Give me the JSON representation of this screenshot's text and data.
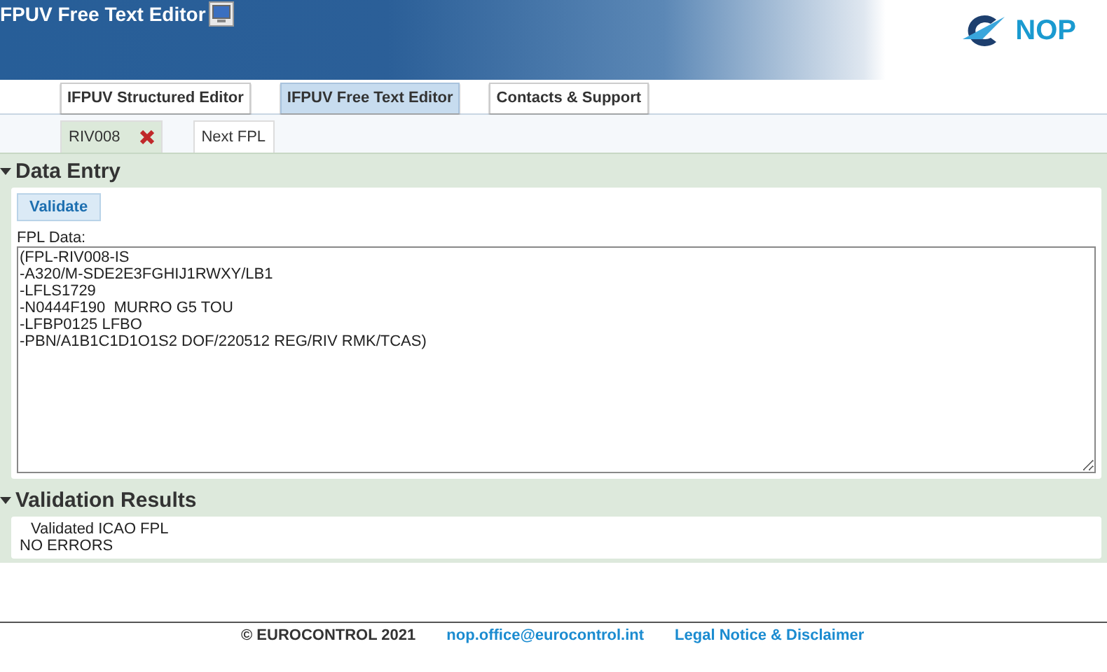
{
  "header": {
    "title": "FPUV Free Text Editor",
    "logo_text": "NOP"
  },
  "nav_tabs": [
    {
      "label": "IFPUV Structured Editor",
      "selected": false
    },
    {
      "label": "IFPUV Free Text Editor",
      "selected": true
    },
    {
      "label": "Contacts & Support",
      "selected": false
    }
  ],
  "doc_tabs": [
    {
      "label": "RIV008",
      "selected": true,
      "closable": true
    },
    {
      "label": "Next FPL",
      "selected": false,
      "closable": false
    }
  ],
  "data_entry": {
    "title": "Data Entry",
    "expanded": true,
    "button": "Validate",
    "field_label": "FPL Data:",
    "lines": [
      "(FPL-RIV008-IS",
      "-A320/M-SDE2E3FGHIJ1RWXY/LB1",
      "-LFLS1729",
      "-N0444F190  MURRO G5 TOU",
      "-LFBP0125 LFBO",
      "-PBN/A1B1C1D1O1S2 DOF/220512 REG/RIV RMK/TCAS)"
    ]
  },
  "validation_results": {
    "title": "Validation Results",
    "expanded": true,
    "heading": "Validated ICAO FPL",
    "message": "NO ERRORS"
  },
  "footer": {
    "copyright": "© EUROCONTROL 2021",
    "email": "nop.office@eurocontrol.int",
    "legal": "Legal Notice & Disclaimer"
  }
}
